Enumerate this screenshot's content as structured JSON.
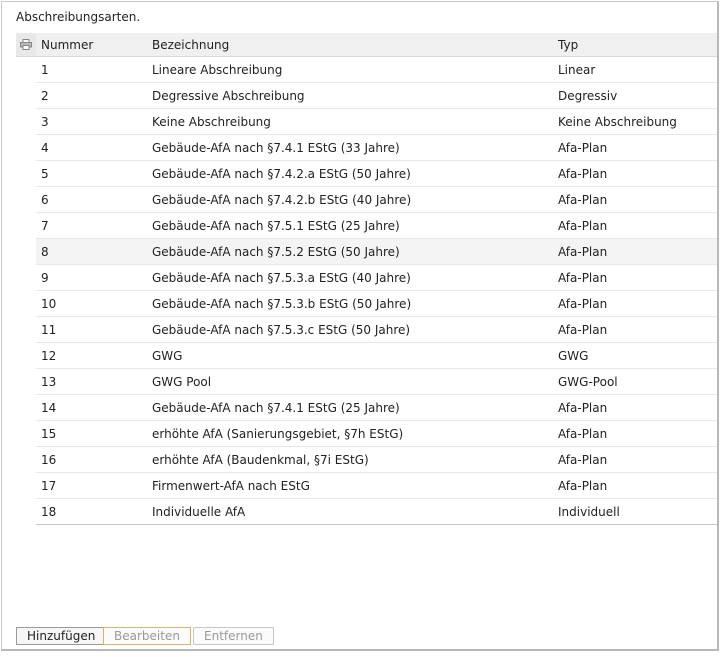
{
  "title": "Abschreibungsarten.",
  "columns": {
    "num": "Nummer",
    "bez": "Bezeichnung",
    "typ": "Typ"
  },
  "rows": [
    {
      "num": "1",
      "bez": "Lineare Abschreibung",
      "typ": "Linear"
    },
    {
      "num": "2",
      "bez": "Degressive Abschreibung",
      "typ": "Degressiv"
    },
    {
      "num": "3",
      "bez": "Keine Abschreibung",
      "typ": "Keine Abschreibung"
    },
    {
      "num": "4",
      "bez": "Gebäude-AfA nach §7.4.1 EStG (33 Jahre)",
      "typ": "Afa-Plan"
    },
    {
      "num": "5",
      "bez": "Gebäude-AfA nach §7.4.2.a EStG (50 Jahre)",
      "typ": "Afa-Plan"
    },
    {
      "num": "6",
      "bez": "Gebäude-AfA nach §7.4.2.b EStG (40 Jahre)",
      "typ": "Afa-Plan"
    },
    {
      "num": "7",
      "bez": "Gebäude-AfA nach §7.5.1 EStG (25 Jahre)",
      "typ": "Afa-Plan"
    },
    {
      "num": "8",
      "bez": "Gebäude-AfA nach §7.5.2 EStG (50 Jahre)",
      "typ": "Afa-Plan"
    },
    {
      "num": "9",
      "bez": "Gebäude-AfA nach §7.5.3.a EStG (40 Jahre)",
      "typ": "Afa-Plan"
    },
    {
      "num": "10",
      "bez": "Gebäude-AfA nach §7.5.3.b EStG (50 Jahre)",
      "typ": "Afa-Plan"
    },
    {
      "num": "11",
      "bez": "Gebäude-AfA nach §7.5.3.c EStG (50 Jahre)",
      "typ": "Afa-Plan"
    },
    {
      "num": "12",
      "bez": "GWG",
      "typ": "GWG"
    },
    {
      "num": "13",
      "bez": "GWG Pool",
      "typ": "GWG-Pool"
    },
    {
      "num": "14",
      "bez": "Gebäude-AfA nach §7.4.1 EStG (25 Jahre)",
      "typ": "Afa-Plan"
    },
    {
      "num": "15",
      "bez": "erhöhte AfA (Sanierungsgebiet, §7h EStG)",
      "typ": "Afa-Plan"
    },
    {
      "num": "16",
      "bez": "erhöhte AfA (Baudenkmal, §7i EStG)",
      "typ": "Afa-Plan"
    },
    {
      "num": "17",
      "bez": "Firmenwert-AfA nach EStG",
      "typ": "Afa-Plan"
    },
    {
      "num": "18",
      "bez": "Individuelle AfA",
      "typ": "Individuell"
    }
  ],
  "selected_row": "8",
  "buttons": {
    "add": "Hinzufügen",
    "edit": "Bearbeiten",
    "remove": "Entfernen"
  },
  "icons": {
    "print": "print-icon"
  }
}
